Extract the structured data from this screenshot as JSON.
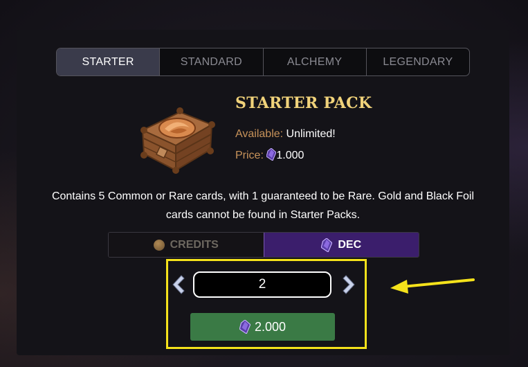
{
  "tabs": [
    "STARTER",
    "STANDARD",
    "ALCHEMY",
    "LEGENDARY"
  ],
  "pack": {
    "title": "STARTER PACK",
    "available_label": "Available:",
    "available_value": "Unlimited!",
    "price_label": "Price:",
    "price_value": "1.000",
    "price_icon": "dec-gem-icon"
  },
  "description": "Contains 5 Common or Rare cards, with 1 guaranteed to be Rare. Gold and Black Foil cards cannot be found in Starter Packs.",
  "currency": {
    "credits_label": "CREDITS",
    "dec_label": "DEC",
    "selected": "DEC"
  },
  "quantity": {
    "value": "2"
  },
  "buy_button": {
    "label": "2.000",
    "icon": "dec-gem-icon"
  },
  "colors": {
    "title_gold": "#f0d27a",
    "label_orange": "#c8935a",
    "dec_purple": "#3b1e6c",
    "buy_green": "#3a7a45",
    "annotation_yellow": "#f5e21b"
  }
}
